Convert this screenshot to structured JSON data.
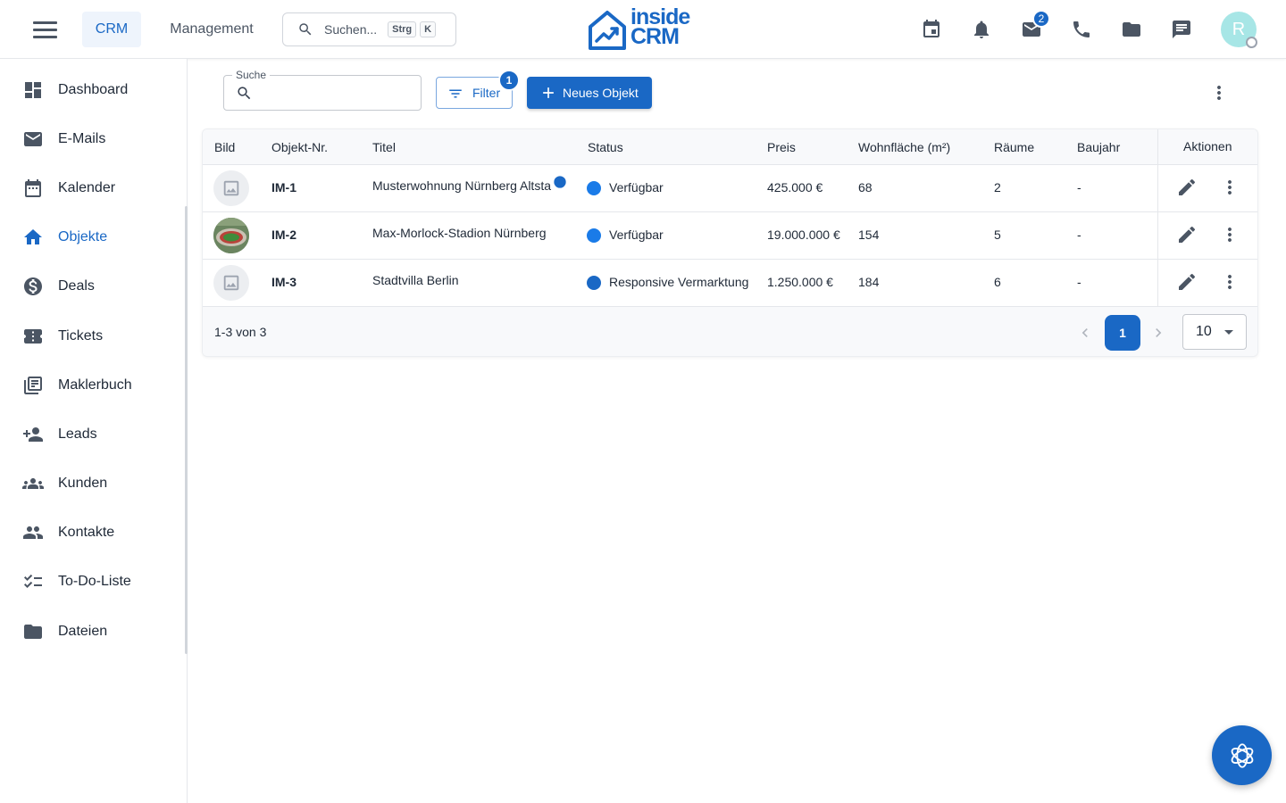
{
  "header": {
    "tabs": [
      {
        "label": "CRM"
      },
      {
        "label": "Management"
      }
    ],
    "search": {
      "placeholder": "Suchen...",
      "shortcut_1": "Strg",
      "shortcut_2": "K"
    },
    "logo": {
      "line1": "inside",
      "line2": "CRM"
    },
    "mail_badge": "2",
    "avatar_initial": "R"
  },
  "sidebar": {
    "items": [
      {
        "label": "Dashboard",
        "icon": "dashboard-icon"
      },
      {
        "label": "E-Mails",
        "icon": "mail-icon"
      },
      {
        "label": "Kalender",
        "icon": "calendar-icon"
      },
      {
        "label": "Objekte",
        "icon": "home-icon",
        "active": true
      },
      {
        "label": "Deals",
        "icon": "dollar-icon"
      },
      {
        "label": "Tickets",
        "icon": "ticket-icon"
      },
      {
        "label": "Maklerbuch",
        "icon": "library-icon"
      },
      {
        "label": "Leads",
        "icon": "person-add-icon"
      },
      {
        "label": "Kunden",
        "icon": "groups-icon"
      },
      {
        "label": "Kontakte",
        "icon": "people-icon"
      },
      {
        "label": "To-Do-Liste",
        "icon": "checklist-icon"
      },
      {
        "label": "Dateien",
        "icon": "folder-icon"
      }
    ]
  },
  "toolbar": {
    "search_label": "Suche",
    "filter_label": "Filter",
    "filter_count": "1",
    "new_label": "Neues Objekt"
  },
  "table": {
    "columns": {
      "image": "Bild",
      "number": "Objekt-Nr.",
      "title": "Titel",
      "status": "Status",
      "price": "Preis",
      "area": "Wohnfläche (m²)",
      "rooms": "Räume",
      "year": "Baujahr",
      "actions": "Aktionen"
    },
    "rows": [
      {
        "number": "IM-1",
        "title": "Musterwohnung Nürnberg Altsta",
        "status": "Verfügbar",
        "price": "425.000 €",
        "area": "68",
        "rooms": "2",
        "year": "-"
      },
      {
        "number": "IM-2",
        "title": "Max-Morlock-Stadion Nürnberg",
        "status": "Verfügbar",
        "price": "19.000.000 €",
        "area": "154",
        "rooms": "5",
        "year": "-"
      },
      {
        "number": "IM-3",
        "title": "Stadtvilla Berlin",
        "status": "Responsive Vermarktung",
        "price": "1.250.000 €",
        "area": "184",
        "rooms": "6",
        "year": "-"
      }
    ],
    "range_text": "1-3 von 3",
    "current_page": "1",
    "per_page": "10"
  },
  "colors": {
    "primary": "#1a68c5",
    "status_available": "#1a7be8",
    "status_marketing": "#1a68c5"
  }
}
